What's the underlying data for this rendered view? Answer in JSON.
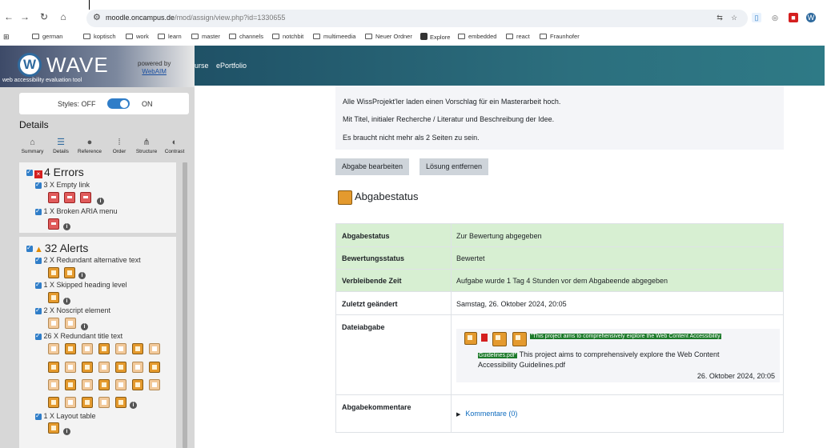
{
  "browser": {
    "url_host": "moodle.oncampus.de",
    "url_path": "/mod/assign/view.php?id=1330655",
    "bookmarks": [
      "german",
      "koptisch",
      "work",
      "learn",
      "master",
      "channels",
      "notchbit",
      "multimeedia",
      "Neuer Ordner",
      "Explore",
      "embedded",
      "react",
      "Fraunhofer"
    ]
  },
  "topnav": {
    "items": [
      "urse",
      "ePortfolio"
    ]
  },
  "wave": {
    "logo": "WAVE",
    "tagline": "web accessibility evaluation tool",
    "powered_by": "powered by",
    "webaim": "WebAIM",
    "styles_label": "Styles:",
    "styles_off": "OFF",
    "styles_on": "ON",
    "details_heading": "Details",
    "tabs": [
      "Summary",
      "Details",
      "Reference",
      "Order",
      "Structure",
      "Contrast"
    ],
    "errors": {
      "title": "4 Errors",
      "items": [
        "3 X Empty link",
        "1 X Broken ARIA menu"
      ]
    },
    "alerts": {
      "title": "32 Alerts",
      "items": [
        "2 X Redundant alternative text",
        "1 X Skipped heading level",
        "2 X Noscript element",
        "26 X Redundant title text",
        "1 X Layout table"
      ]
    }
  },
  "main": {
    "description": [
      "Alle WissProjekt'ler laden einen Vorschlag für ein Masterarbeit hoch.",
      "Mit Titel, initialer Recherche / Literatur und Beschreibung der Idee.",
      "Es braucht nicht mehr als 2 Seiten zu sein."
    ],
    "edit_button": "Abgabe bearbeiten",
    "remove_button": "Lösung entfernen",
    "status_heading": "Abgabestatus",
    "table": {
      "rows": [
        {
          "label": "Abgabestatus",
          "value": "Zur Bewertung abgegeben"
        },
        {
          "label": "Bewertungsstatus",
          "value": "Bewertet"
        },
        {
          "label": "Verbleibende Zeit",
          "value": "Aufgabe wurde 1 Tag 4 Stunden vor dem Abgabeende abgegeben"
        },
        {
          "label": "Zuletzt geändert",
          "value": "Samstag, 26. Oktober 2024, 20:05"
        },
        {
          "label": "Dateiabgabe",
          "value": ""
        },
        {
          "label": "Abgabekommentare",
          "value": ""
        }
      ],
      "file_title_highlight_1": "\"This project aims to comprehensively explore the Web Content Accessibility",
      "file_title_highlight_2": "Guidelines.pdf\"",
      "file_name_1": " This project aims to comprehensively explore the Web Content",
      "file_name_2": "Accessibility Guidelines.pdf",
      "file_date": "26. Oktober 2024, 20:05",
      "comments_link": "Kommentare (0)"
    }
  }
}
